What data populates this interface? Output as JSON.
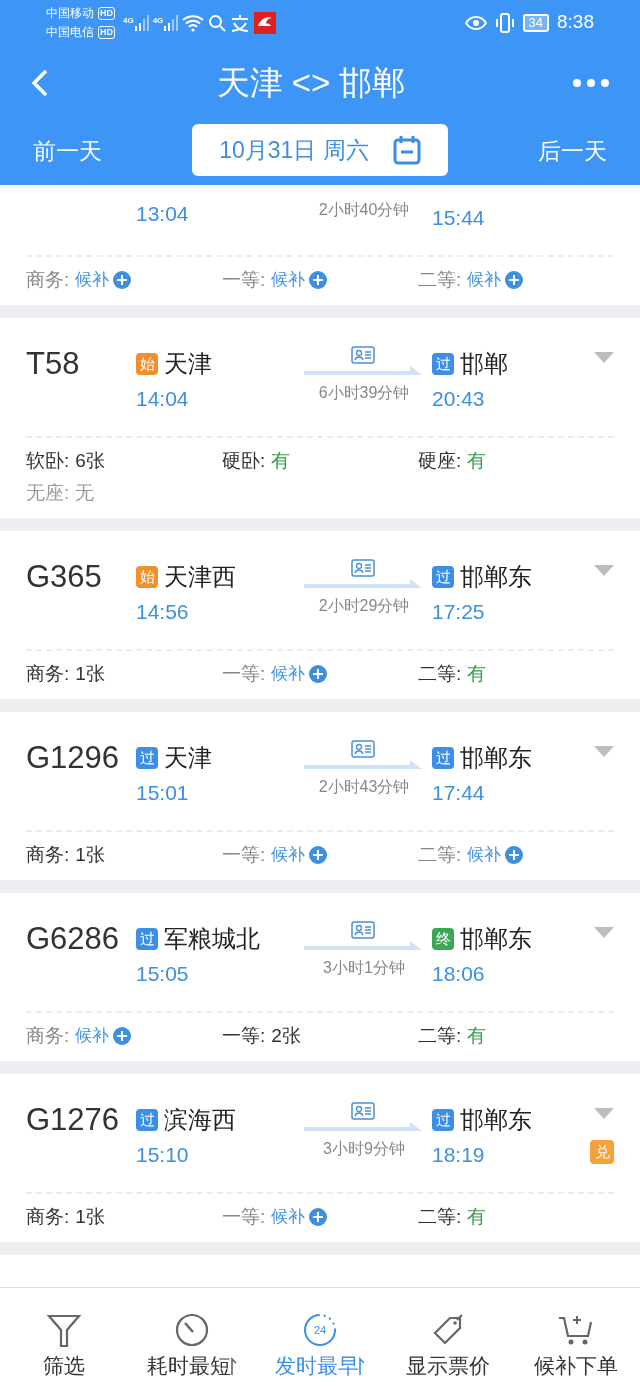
{
  "status_bar": {
    "carriers": [
      {
        "name": "中国移动",
        "badge": "HD",
        "network": "4G"
      },
      {
        "name": "中国电信",
        "badge": "HD",
        "network": "4G"
      }
    ],
    "battery": "34",
    "time": "8:38"
  },
  "header": {
    "title": "天津 <> 邯郸",
    "prev_day": "前一天",
    "date": "10月31日 周六",
    "next_day": "后一天"
  },
  "trains": [
    {
      "depart_time": "13:04",
      "duration": "2小时40分钟",
      "arrive_time": "15:44",
      "seats": [
        {
          "label": "商务:",
          "kind": "waitlist",
          "value": "候补"
        },
        {
          "label": "一等:",
          "kind": "waitlist",
          "value": "候补"
        },
        {
          "label": "二等:",
          "kind": "waitlist",
          "value": "候补"
        }
      ]
    },
    {
      "number": "T58",
      "from": {
        "badge": "始",
        "color": "#f0902a",
        "name": "天津"
      },
      "to": {
        "badge": "过",
        "color": "#3d8fe6",
        "name": "邯郸"
      },
      "depart_time": "14:04",
      "duration": "6小时39分钟",
      "arrive_time": "20:43",
      "seats": [
        {
          "label": "软卧:",
          "kind": "count",
          "value": "6张"
        },
        {
          "label": "硬卧:",
          "kind": "yes",
          "value": "有"
        },
        {
          "label": "硬座:",
          "kind": "yes",
          "value": "有"
        },
        {
          "label": "无座:",
          "kind": "none",
          "value": "无"
        }
      ]
    },
    {
      "number": "G365",
      "from": {
        "badge": "始",
        "color": "#f0902a",
        "name": "天津西"
      },
      "to": {
        "badge": "过",
        "color": "#3d8fe6",
        "name": "邯郸东"
      },
      "depart_time": "14:56",
      "duration": "2小时29分钟",
      "arrive_time": "17:25",
      "seats": [
        {
          "label": "商务:",
          "kind": "count",
          "value": "1张"
        },
        {
          "label": "一等:",
          "kind": "waitlist",
          "value": "候补"
        },
        {
          "label": "二等:",
          "kind": "yes",
          "value": "有"
        }
      ]
    },
    {
      "number": "G1296",
      "from": {
        "badge": "过",
        "color": "#3d8fe6",
        "name": "天津"
      },
      "to": {
        "badge": "过",
        "color": "#3d8fe6",
        "name": "邯郸东"
      },
      "depart_time": "15:01",
      "duration": "2小时43分钟",
      "arrive_time": "17:44",
      "seats": [
        {
          "label": "商务:",
          "kind": "count",
          "value": "1张"
        },
        {
          "label": "一等:",
          "kind": "waitlist",
          "value": "候补"
        },
        {
          "label": "二等:",
          "kind": "waitlist",
          "value": "候补"
        }
      ]
    },
    {
      "number": "G6286",
      "from": {
        "badge": "过",
        "color": "#3d8fe6",
        "name": "军粮城北"
      },
      "to": {
        "badge": "终",
        "color": "#3da853",
        "name": "邯郸东"
      },
      "depart_time": "15:05",
      "duration": "3小时1分钟",
      "arrive_time": "18:06",
      "seats": [
        {
          "label": "商务:",
          "kind": "waitlist",
          "value": "候补"
        },
        {
          "label": "一等:",
          "kind": "count",
          "value": "2张"
        },
        {
          "label": "二等:",
          "kind": "yes",
          "value": "有"
        }
      ]
    },
    {
      "number": "G1276",
      "from": {
        "badge": "过",
        "color": "#3d8fe6",
        "name": "滨海西"
      },
      "to": {
        "badge": "过",
        "color": "#3d8fe6",
        "name": "邯郸东"
      },
      "depart_time": "15:10",
      "duration": "3小时9分钟",
      "arrive_time": "18:19",
      "tag": "兑",
      "seats": [
        {
          "label": "商务:",
          "kind": "count",
          "value": "1张"
        },
        {
          "label": "一等:",
          "kind": "waitlist",
          "value": "候补"
        },
        {
          "label": "二等:",
          "kind": "yes",
          "value": "有"
        }
      ]
    }
  ],
  "bottom_tabs": [
    {
      "kind": "filter",
      "label": "筛选",
      "sort": false,
      "selected": false
    },
    {
      "kind": "timer",
      "label": "耗时最短",
      "sort": true,
      "selected": false
    },
    {
      "kind": "clock24",
      "label": "发时最早",
      "sort": true,
      "selected": true,
      "icon_text": "24"
    },
    {
      "kind": "tag",
      "label": "显示票价",
      "sort": false,
      "selected": false
    },
    {
      "kind": "cart",
      "label": "候补下单",
      "sort": false,
      "selected": false
    }
  ]
}
